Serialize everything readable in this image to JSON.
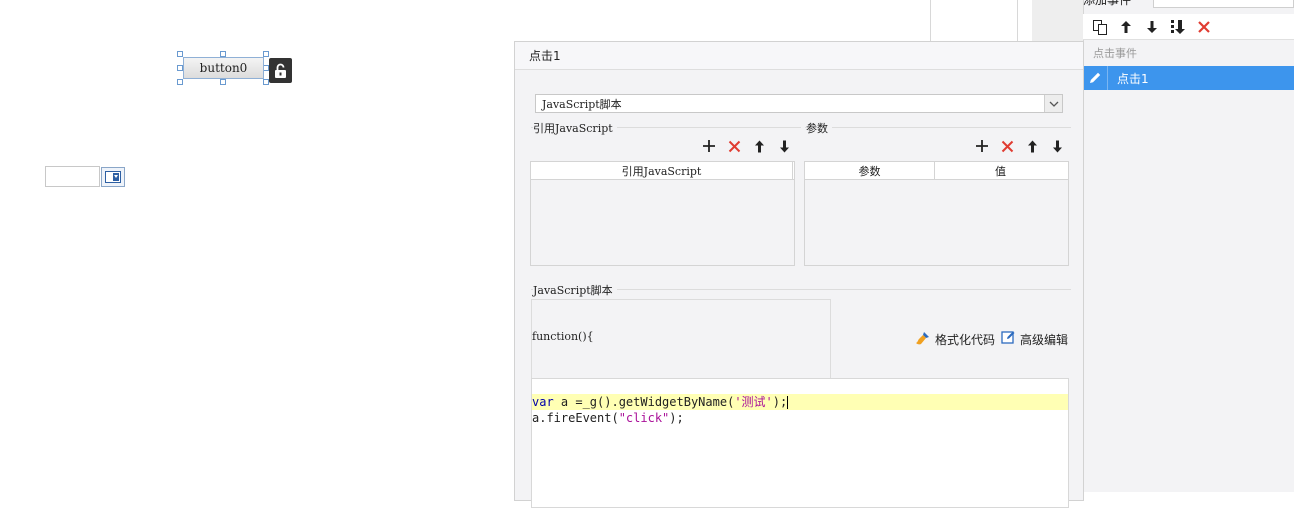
{
  "canvas": {
    "button_label": "button0"
  },
  "right_panel": {
    "add_event_label": "添加事件",
    "section_label": "点击事件",
    "selected_item": "点击1"
  },
  "dialog": {
    "title": "点击1",
    "type_select_value": "JavaScript脚本",
    "ref_js_group": "引用JavaScript",
    "params_group": "参数",
    "ref_js_header": "引用JavaScript",
    "params_header_name": "参数",
    "params_header_value": "值",
    "script_group": "JavaScript脚本",
    "fn_signature": "function(){",
    "format_code_label": "格式化代码",
    "advanced_edit_label": "高级编辑",
    "code": {
      "line1": {
        "kw": "var",
        "rest_a": " a =_g().getWidgetByName(",
        "str": "'测试'",
        "rest_b": ");"
      },
      "line2": {
        "rest_a": "a.fireEvent(",
        "str": "\"click\"",
        "rest_b": ");"
      }
    }
  },
  "colors": {
    "accent": "#3d95ed",
    "delete": "#e03c31",
    "highlight_line": "#ffffb4"
  },
  "icons": [
    "plus-icon",
    "close-icon",
    "arrow-up-icon",
    "arrow-down-icon",
    "copy-icon",
    "move-bottom-icon",
    "lock-open-icon",
    "pencil-icon",
    "brush-icon",
    "edit-icon",
    "chevron-down-icon",
    "calendar-icon"
  ]
}
